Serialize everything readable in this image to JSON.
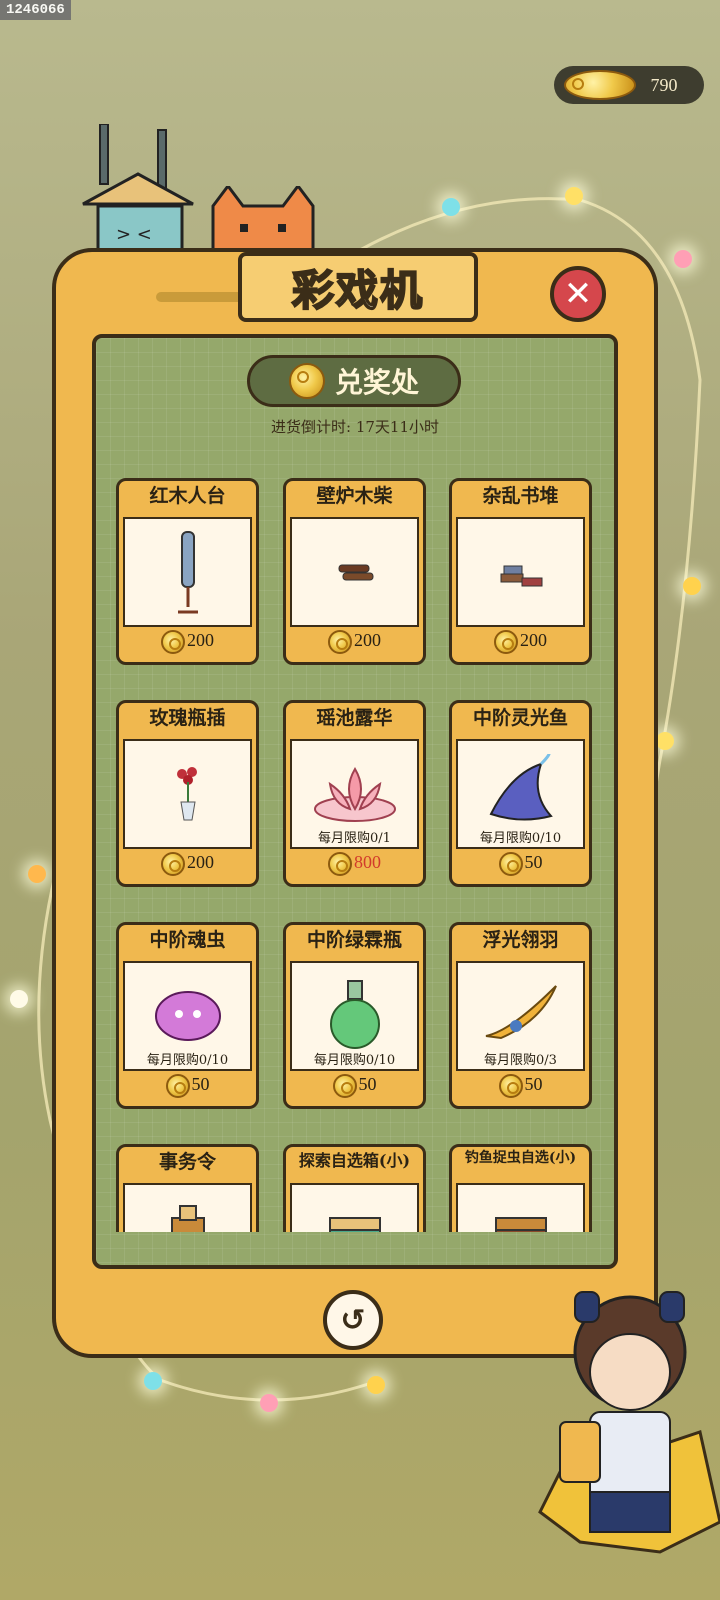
{
  "watermark": "1246066",
  "currency": {
    "amount": "790",
    "icon": "coin-icon"
  },
  "title": "彩戏机",
  "close_label": "✕",
  "section": {
    "title": "兑奖处",
    "icon": "coin-icon"
  },
  "countdown": "进货倒计时: 17天11小时",
  "items": [
    {
      "name": "红木人台",
      "limit": "",
      "price": "200",
      "price_color": "#2a2214"
    },
    {
      "name": "壁炉木柴",
      "limit": "",
      "price": "200",
      "price_color": "#2a2214"
    },
    {
      "name": "杂乱书堆",
      "limit": "",
      "price": "200",
      "price_color": "#2a2214"
    },
    {
      "name": "玫瑰瓶插",
      "limit": "",
      "price": "200",
      "price_color": "#2a2214"
    },
    {
      "name": "瑶池露华",
      "limit": "每月限购0/1",
      "price": "800",
      "price_color": "#d23b2b"
    },
    {
      "name": "中阶灵光鱼",
      "limit": "每月限购0/10",
      "price": "50",
      "price_color": "#2a2214"
    },
    {
      "name": "中阶魂虫",
      "limit": "每月限购0/10",
      "price": "50",
      "price_color": "#2a2214"
    },
    {
      "name": "中阶绿霖瓶",
      "limit": "每月限购0/10",
      "price": "50",
      "price_color": "#2a2214"
    },
    {
      "name": "浮光翎羽",
      "limit": "每月限购0/3",
      "price": "50",
      "price_color": "#2a2214"
    },
    {
      "name": "事务令",
      "limit": "",
      "price": "",
      "price_color": "#2a2214"
    },
    {
      "name": "探索自选箱(小)",
      "limit": "",
      "price": "",
      "price_color": "#2a2214"
    },
    {
      "name": "钓鱼捉虫自选(小)",
      "limit": "",
      "price": "",
      "price_color": "#2a2214"
    }
  ],
  "refresh_icon": "refresh-icon"
}
